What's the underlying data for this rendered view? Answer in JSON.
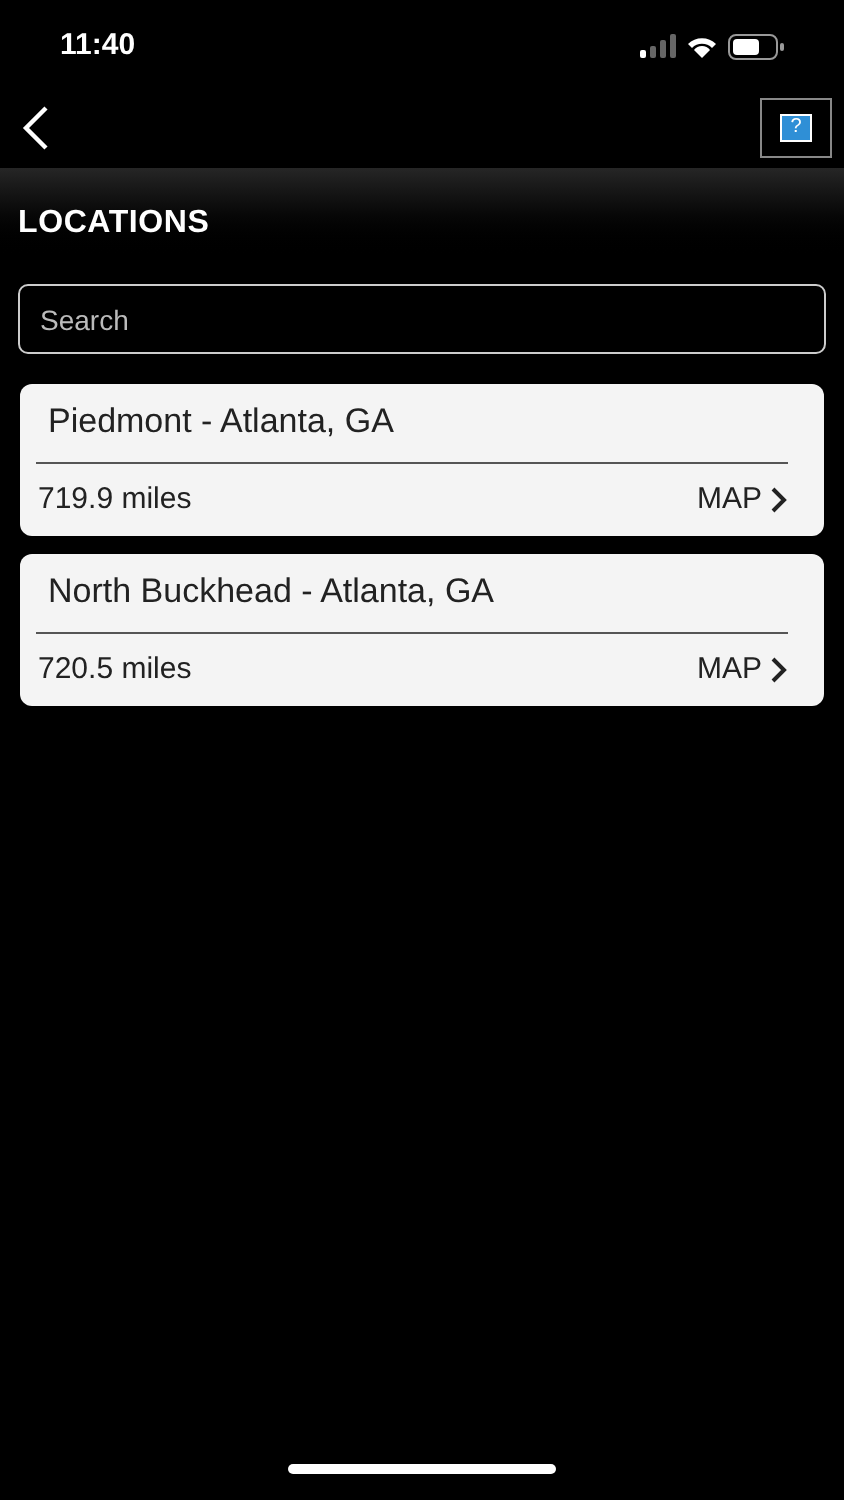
{
  "status_bar": {
    "time": "11:40"
  },
  "nav": {
    "help_label": "?"
  },
  "header": {
    "title": "LOCATIONS"
  },
  "search": {
    "placeholder": "Search"
  },
  "locations": [
    {
      "name": "Piedmont - Atlanta, GA",
      "distance": "719.9 miles",
      "map_label": "MAP"
    },
    {
      "name": "North Buckhead - Atlanta, GA",
      "distance": "720.5 miles",
      "map_label": "MAP"
    }
  ]
}
